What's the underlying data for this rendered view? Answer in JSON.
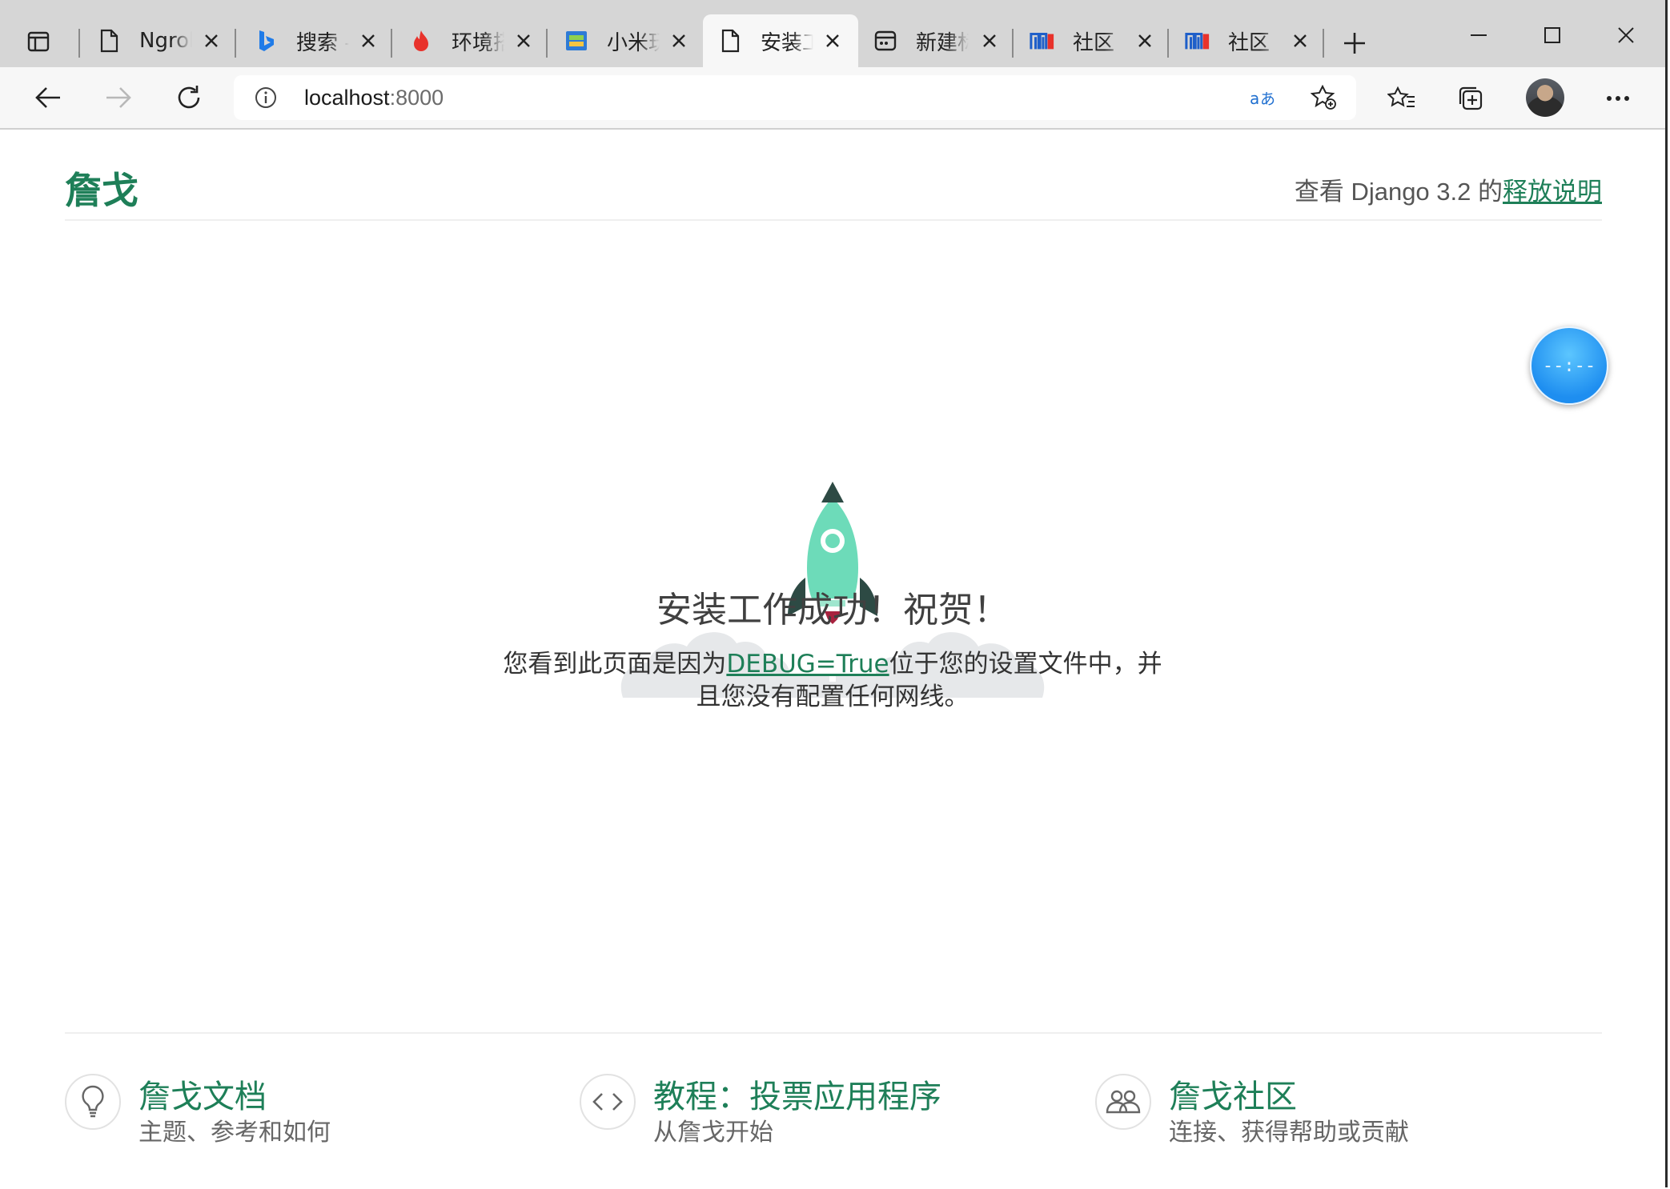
{
  "browser": {
    "tabs": [
      {
        "title": "Ngrok",
        "icon": "page-icon"
      },
      {
        "title": "搜索 -",
        "icon": "bing-icon"
      },
      {
        "title": "环境搭",
        "icon": "flame-icon"
      },
      {
        "title": "小米玩",
        "icon": "app-icon"
      },
      {
        "title": "安装工",
        "icon": "page-icon",
        "active": true
      },
      {
        "title": "新建标",
        "icon": "newtab-icon"
      },
      {
        "title": "社区",
        "icon": "mi-icon"
      },
      {
        "title": "社区",
        "icon": "mi-icon"
      }
    ],
    "address": {
      "host": "localhost",
      "port": ":8000"
    }
  },
  "page": {
    "logo": "詹戈",
    "release_prefix": "查看 Django 3.2 的",
    "release_link": "释放说明",
    "success_title": "安装工作成功！祝贺！",
    "desc_before": "您看到此页面是因为",
    "desc_link": "DEBUG=True",
    "desc_after": "位于您的设置文件中，并且您没有配置任何网线。",
    "footer": [
      {
        "title": "詹戈文档",
        "subtitle": "主题、参考和如何",
        "icon": "lightbulb-icon"
      },
      {
        "title": "教程：投票应用程序",
        "subtitle": "从詹戈开始",
        "icon": "code-icon"
      },
      {
        "title": "詹戈社区",
        "subtitle": "连接、获得帮助或贡献",
        "icon": "people-icon"
      }
    ]
  },
  "widget": {
    "text": "--:--"
  },
  "colors": {
    "accent": "#1e7f58",
    "rocket": "#6ddbb9",
    "rocket_dark": "#2d4a44",
    "flame": "#a8233f",
    "cloud": "#e6e8ea"
  }
}
